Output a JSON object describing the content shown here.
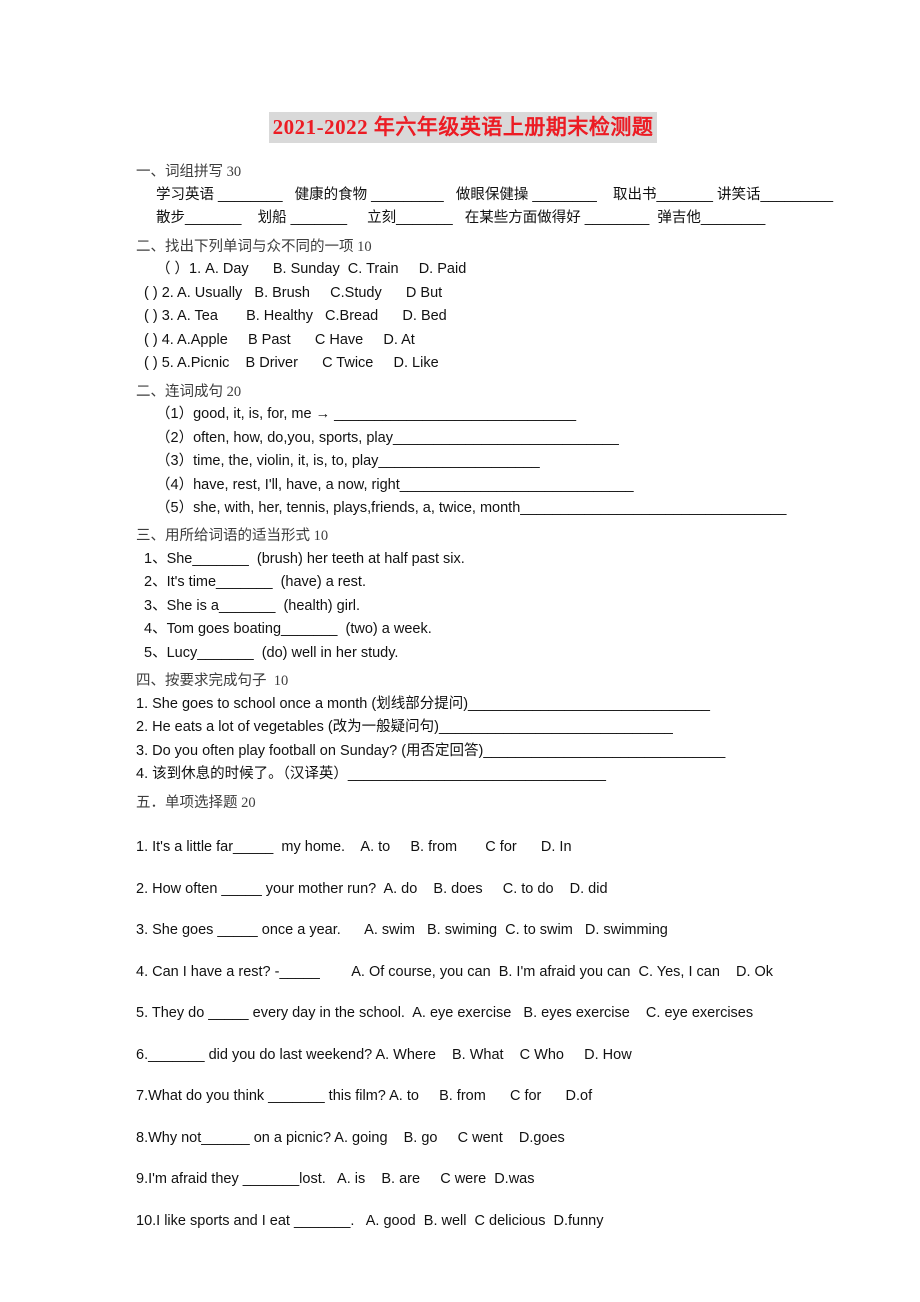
{
  "document": {
    "title": "2021-2022 年六年级英语上册期末检测题",
    "title_color": "#ec1c24",
    "title_highlight": "#d9d9d9"
  },
  "section1": {
    "heading": "一、词组拼写 30",
    "line1": "学习英语 ________   健康的食物 _________   做眼保健操 ________    取出书_______ 讲笑话_________",
    "line2": "散步_______    划船 _______     立刻_______   在某些方面做得好 ________  弹吉他________"
  },
  "section2": {
    "heading": "二、找出下列单词与众不同的一项 10",
    "items": [
      "（ ）1. A. Day      B. Sunday  C. Train     D. Paid",
      "( ) 2. A. Usually   B. Brush     C.Study      D But",
      "( ) 3. A. Tea       B. Healthy   C.Bread      D. Bed",
      "( ) 4. A.Apple     B Past      C Have     D. At",
      "( ) 5. A.Picnic    B Driver      C Twice     D. Like"
    ]
  },
  "section3": {
    "heading": "二、连词成句 20",
    "items": [
      "（1）good, it, is, for, me → ______________________________",
      "（2）often, how, do,you, sports, play____________________________",
      "（3）time, the, violin, it, is, to, play____________________",
      "（4）have, rest, I'll, have, a now, right_____________________________",
      "（5）she, with, her, tennis, plays,friends, a, twice, month_________________________________"
    ]
  },
  "section4": {
    "heading": "三、用所给词语的适当形式 10",
    "items": [
      "1、She_______  (brush) her teeth at half past six.",
      "2、It's time_______  (have) a rest.",
      "3、She is a_______  (health) girl.",
      "4、Tom goes boating_______  (two) a week.",
      "5、Lucy_______  (do) well in her study."
    ]
  },
  "section5": {
    "heading": "四、按要求完成句子  10",
    "items": [
      "1. She goes to school once a month (划线部分提问)______________________________",
      "2. He eats a lot of vegetables (改为一般疑问句)_____________________________",
      "3. Do you often play football on Sunday? (用否定回答)______________________________",
      "4. 该到休息的时候了。（汉译英）________________________________"
    ]
  },
  "section6": {
    "heading": "五．单项选择题 20",
    "items": [
      "1. It's a little far_____  my home.    A. to     B. from       C for      D. In",
      "2. How often _____ your mother run?  A. do    B. does     C. to do    D. did",
      "3. She goes _____ once a year.      A. swim   B. swiming  C. to swim   D. swimming",
      "4. Can I have a rest? -_____        A. Of course, you can  B. I'm afraid you can  C. Yes, I can    D. Ok",
      "5. They do _____ every day in the school.  A. eye exercise   B. eyes exercise    C. eye exercises",
      "6._______ did you do last weekend? A. Where    B. What    C Who     D. How",
      "7.What do you think _______ this film? A. to     B. from      C for      D.of",
      "8.Why not______ on a picnic? A. going    B. go     C went    D.goes",
      "9.I'm afraid they _______lost.   A. is    B. are     C were  D.was",
      "10.I like sports and I eat _______.   A. good  B. well  C delicious  D.funny"
    ]
  }
}
